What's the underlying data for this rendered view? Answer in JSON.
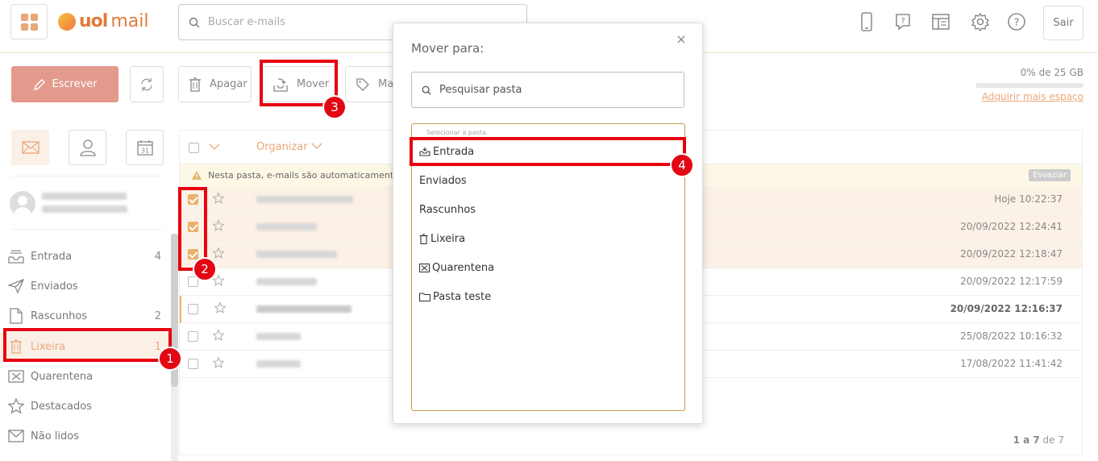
{
  "header": {
    "search_placeholder": "Buscar e-mails",
    "logo_uol": "uol",
    "logo_mail": "mail",
    "sair_label": "Sair"
  },
  "toolbar": {
    "escrever": "Escrever",
    "apagar": "Apagar",
    "mover": "Mover",
    "marcar_partial": "Ma"
  },
  "storage": {
    "usage": "0% de 25 GB",
    "link": "Adquirir mais espaço",
    "fraction_used": 0
  },
  "sidebar": {
    "folders": [
      {
        "label": "Entrada",
        "count": "4"
      },
      {
        "label": "Enviados",
        "count": ""
      },
      {
        "label": "Rascunhos",
        "count": "2"
      },
      {
        "label": "Lixeira",
        "count": "1"
      },
      {
        "label": "Quarentena",
        "count": ""
      },
      {
        "label": "Destacados",
        "count": ""
      },
      {
        "label": "Não lidos",
        "count": ""
      }
    ]
  },
  "list": {
    "organizar": "Organizar",
    "warning": "Nesta pasta, e-mails são automaticamente exc",
    "esvaziar": "Esvaziar",
    "rows": [
      {
        "date": "Hoje 10:22:37"
      },
      {
        "date": "20/09/2022 12:24:41"
      },
      {
        "date": "20/09/2022 12:18:47"
      },
      {
        "date": "20/09/2022 12:17:59"
      },
      {
        "date": "20/09/2022 12:16:37"
      },
      {
        "date": "25/08/2022 10:16:32"
      },
      {
        "date": "17/08/2022 11:41:42"
      }
    ],
    "pagination": {
      "range": "1 a 7",
      "of": "de 7"
    }
  },
  "modal": {
    "title": "Mover para:",
    "close": "×",
    "search_placeholder": "Pesquisar pasta",
    "box_label": "Selecionar a pasta",
    "folders": [
      "Entrada",
      "Enviados",
      "Rascunhos",
      "Lixeira",
      "Quarentena",
      "Pasta teste"
    ]
  },
  "annotations": [
    "1",
    "2",
    "3",
    "4"
  ]
}
